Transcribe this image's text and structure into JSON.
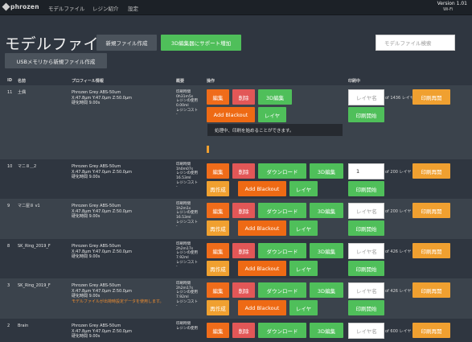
{
  "topbar": {
    "logo": "phrozen",
    "nav": [
      "モデルファイル",
      "レジン紹介",
      "設定"
    ],
    "wifi": "Wi-Fi",
    "version": "Version 1.01"
  },
  "header": {
    "title": "モデルファイル",
    "new_file_button": "新規ファイル作成",
    "support_button": "3D編集器にサポート増加",
    "usb_button": "USBメモリから新規ファイル作成",
    "search_placeholder": "モデルファイル検索"
  },
  "table": {
    "headers": {
      "id": "ID",
      "name": "名前",
      "profile": "プロフィール情報",
      "summary": "概要",
      "actions": "操作",
      "printing": "印刷中"
    },
    "labels": {
      "edit": "編集",
      "delete": "削除",
      "edit_3d": "3D編集",
      "download": "ダウンロード",
      "recreate": "再作成",
      "blackout": "Add Blackout",
      "layer": "レイヤ",
      "reprint": "印刷再開",
      "start_print": "印刷開始",
      "layer_placeholder": "レイヤ名",
      "print_time_label": "印刷時間",
      "resin_use_label": "レジンの使用",
      "resin_cost_label": "レジンコスト",
      "cure_time": "硬化時間 9.00s",
      "dims": "X:47.8μm Y:47.0μm Z:50.0μm"
    },
    "rows": [
      {
        "id": "11",
        "name": "土偶",
        "profile": "Phrozen Grey ABS-50um",
        "print_time": "0h31m5s",
        "resin_use": "0.00ml",
        "resin_cost": "-",
        "layer_value": "",
        "layer_total": "of 1436 レイヤ",
        "status_message": "処理中、印刷を始めることができます。",
        "progress": 0.02,
        "warning": ""
      },
      {
        "id": "10",
        "name": "マニ８＿2",
        "profile": "Phrozen Grey ABS-50um",
        "print_time": "1h0m07s",
        "resin_use": "16.53ml",
        "resin_cost": "-",
        "layer_value": "1",
        "layer_total": "of 200 レイヤ",
        "warning": ""
      },
      {
        "id": "9",
        "name": "マニ屋８ v1",
        "profile": "Phrozen Grey ABS-50um",
        "print_time": "1h2m1s",
        "resin_use": "16.53ml",
        "resin_cost": "-",
        "layer_value": "",
        "layer_total": "of 200 レイヤ",
        "warning": ""
      },
      {
        "id": "8",
        "name": "SK_Ring_2019_F",
        "profile": "Phrozen Grey ABS-50um",
        "print_time": "2h2m17s",
        "resin_use": "7.92ml",
        "resin_cost": "-",
        "layer_value": "",
        "layer_total": "of 426 レイヤ",
        "warning": ""
      },
      {
        "id": "3",
        "name": "SK_Ring_2019_F",
        "profile": "Phrozen Grey ABS-50um",
        "print_time": "2h2m17s",
        "resin_use": "7.92ml",
        "resin_cost": "-",
        "layer_value": "",
        "layer_total": "of 426 レイヤ",
        "warning": "モデルファイルが出荷時設定データを使用します。"
      },
      {
        "id": "2",
        "name": "Brain",
        "profile": "Phrozen Grey ABS-50um",
        "print_time": "",
        "resin_use": "",
        "resin_cost": "",
        "layer_value": "",
        "layer_total": "of 600 レイヤ",
        "warning": ""
      }
    ]
  },
  "colors": {
    "background": "#2f3640",
    "topbar": "#1c2127",
    "green": "#4fbf5a",
    "orange": "#ef6c1a",
    "red": "#e25757",
    "amber": "#f0a030"
  }
}
